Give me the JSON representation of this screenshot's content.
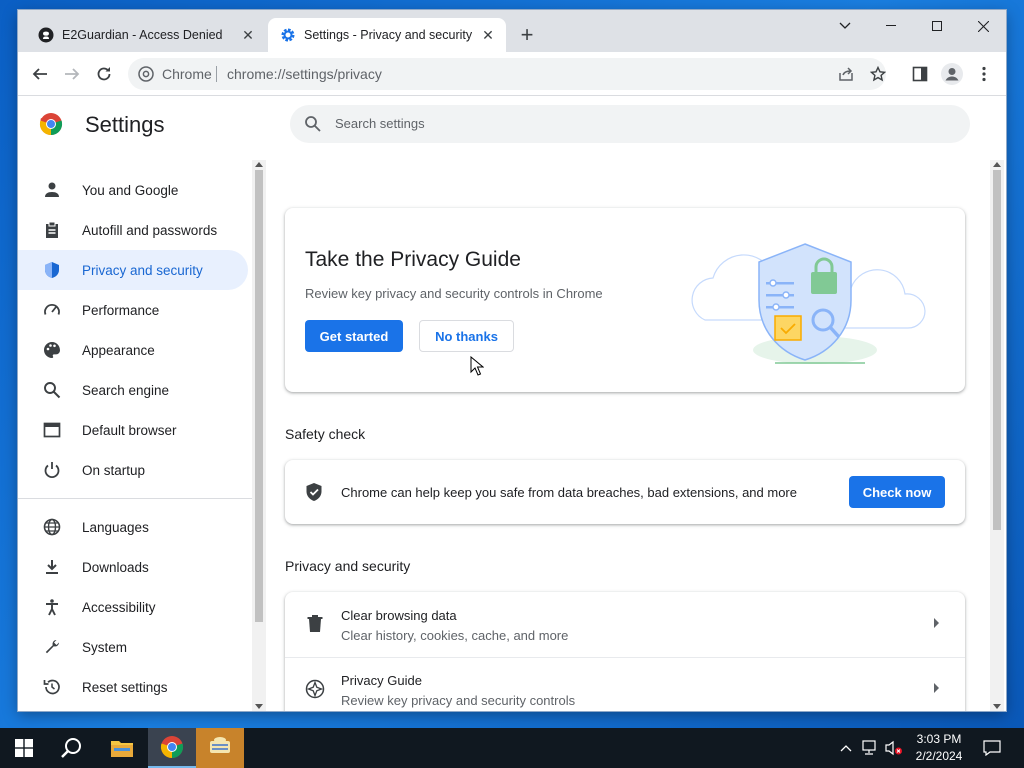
{
  "browser": {
    "tabs": [
      {
        "title": "E2Guardian - Access Denied",
        "icon": "github-icon",
        "active": false
      },
      {
        "title": "Settings - Privacy and security",
        "icon": "gear-icon",
        "active": true
      }
    ],
    "omnibox": {
      "site_label": "Chrome",
      "url": "chrome://settings/privacy"
    }
  },
  "settings": {
    "title": "Settings",
    "search_placeholder": "Search settings",
    "nav": [
      {
        "label": "You and Google",
        "icon": "person-icon",
        "active": false
      },
      {
        "label": "Autofill and passwords",
        "icon": "clipboard-icon",
        "active": false
      },
      {
        "label": "Privacy and security",
        "icon": "shield-icon",
        "active": true
      },
      {
        "label": "Performance",
        "icon": "speedometer-icon",
        "active": false
      },
      {
        "label": "Appearance",
        "icon": "palette-icon",
        "active": false
      },
      {
        "label": "Search engine",
        "icon": "search-icon",
        "active": false
      },
      {
        "label": "Default browser",
        "icon": "browser-icon",
        "active": false
      },
      {
        "label": "On startup",
        "icon": "power-icon",
        "active": false
      },
      {
        "label": "Languages",
        "icon": "globe-icon",
        "active": false
      },
      {
        "label": "Downloads",
        "icon": "download-icon",
        "active": false
      },
      {
        "label": "Accessibility",
        "icon": "accessibility-icon",
        "active": false
      },
      {
        "label": "System",
        "icon": "wrench-icon",
        "active": false
      },
      {
        "label": "Reset settings",
        "icon": "reset-icon",
        "active": false
      }
    ],
    "privacy_guide": {
      "title": "Take the Privacy Guide",
      "description": "Review key privacy and security controls in Chrome",
      "primary_button": "Get started",
      "secondary_button": "No thanks"
    },
    "safety_check": {
      "heading": "Safety check",
      "text": "Chrome can help keep you safe from data breaches, bad extensions, and more",
      "button": "Check now"
    },
    "privacy_section": {
      "heading": "Privacy and security",
      "rows": [
        {
          "title": "Clear browsing data",
          "subtitle": "Clear history, cookies, cache, and more",
          "icon": "trash-icon"
        },
        {
          "title": "Privacy Guide",
          "subtitle": "Review key privacy and security controls",
          "icon": "compass-icon"
        }
      ]
    }
  },
  "taskbar": {
    "time": "3:03 PM",
    "date": "2/2/2024"
  },
  "colors": {
    "accent": "#1a73e8",
    "active_nav_bg": "#e8f0fe",
    "taskbar": "#101820"
  }
}
